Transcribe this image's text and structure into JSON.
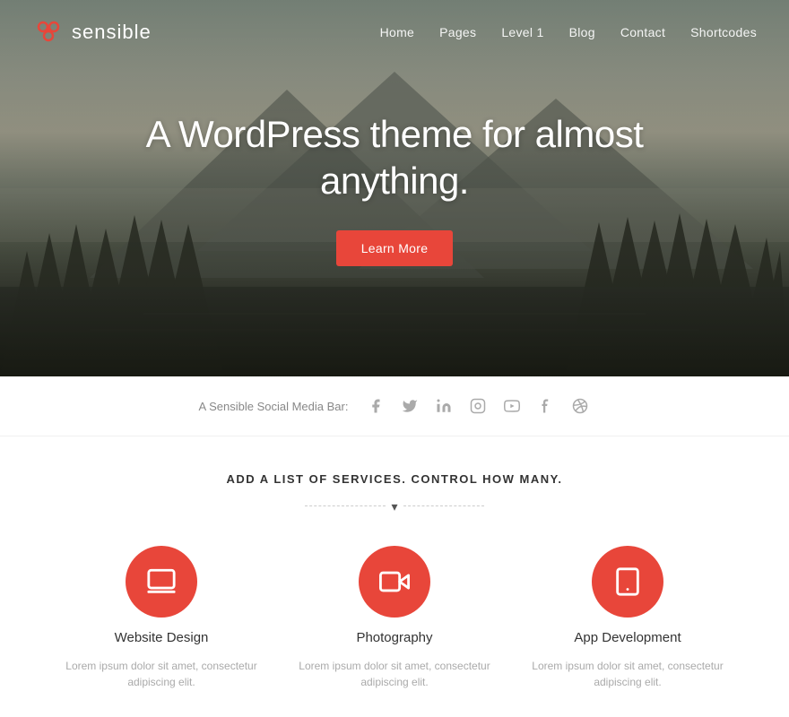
{
  "logo": {
    "text": "sensible"
  },
  "nav": {
    "items": [
      {
        "label": "Home",
        "href": "#"
      },
      {
        "label": "Pages",
        "href": "#"
      },
      {
        "label": "Level 1",
        "href": "#"
      },
      {
        "label": "Blog",
        "href": "#"
      },
      {
        "label": "Contact",
        "href": "#"
      },
      {
        "label": "Shortcodes",
        "href": "#"
      }
    ]
  },
  "hero": {
    "title": "A WordPress theme for almost anything.",
    "cta_label": "Learn More"
  },
  "social_bar": {
    "label": "A Sensible Social Media Bar:",
    "icons": [
      {
        "name": "facebook",
        "symbol": "f"
      },
      {
        "name": "twitter",
        "symbol": "t"
      },
      {
        "name": "linkedin",
        "symbol": "in"
      },
      {
        "name": "instagram",
        "symbol": "ig"
      },
      {
        "name": "youtube",
        "symbol": "yt"
      },
      {
        "name": "tumblr",
        "symbol": "tm"
      },
      {
        "name": "dribbble",
        "symbol": "dr"
      }
    ]
  },
  "services_section": {
    "title": "ADD A LIST OF SERVICES. CONTROL HOW MANY.",
    "items": [
      {
        "name": "Website Design",
        "icon": "laptop",
        "desc": "Lorem ipsum dolor sit amet, consectetur adipiscing elit."
      },
      {
        "name": "Photography",
        "icon": "camera",
        "desc": "Lorem ipsum dolor sit amet, consectetur adipiscing elit."
      },
      {
        "name": "App Development",
        "icon": "tablet",
        "desc": "Lorem ipsum dolor sit amet, consectetur adipiscing elit."
      }
    ]
  }
}
